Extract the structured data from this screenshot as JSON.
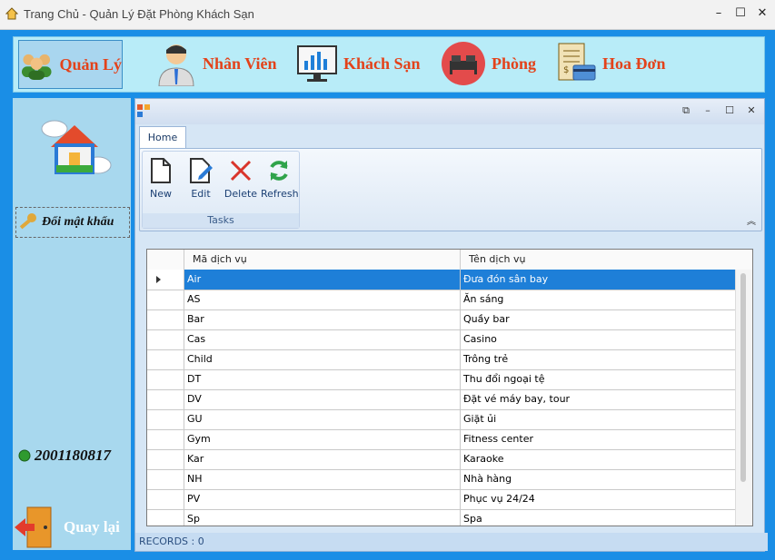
{
  "window": {
    "title": "Trang Chủ - Quản Lý Đặt Phòng Khách Sạn",
    "controls": [
      "–",
      "☐",
      "✕"
    ]
  },
  "topnav": [
    {
      "label": "Quản Lý",
      "icon": "users-group-icon"
    },
    {
      "label": "Nhân Viên",
      "icon": "employee-icon"
    },
    {
      "label": "Khách Sạn",
      "icon": "monitor-chart-icon"
    },
    {
      "label": "Phòng",
      "icon": "bed-icon"
    },
    {
      "label": "Hoa Đơn",
      "icon": "invoice-icon"
    }
  ],
  "sidebar": {
    "change_password": "Đổi mật khẩu",
    "user_id": "2001180817",
    "back": "Quay lại"
  },
  "child": {
    "tab": "Home",
    "ribbon": {
      "group": "Tasks",
      "buttons": [
        "New",
        "Edit",
        "Delete",
        "Refresh"
      ]
    },
    "grid": {
      "headers": [
        "Mã dịch vụ",
        "Tên dịch vụ"
      ],
      "rows": [
        [
          "Air",
          "Đưa đón sân bay"
        ],
        [
          "AS",
          "Ăn sáng"
        ],
        [
          "Bar",
          "Quầy bar"
        ],
        [
          "Cas",
          "Casino"
        ],
        [
          "Child",
          "Trông trẻ"
        ],
        [
          "DT",
          "Thu đổi ngoại tệ"
        ],
        [
          "DV",
          "Đặt vé máy bay, tour"
        ],
        [
          "GU",
          "Giặt ủi"
        ],
        [
          "Gym",
          "Fitness center"
        ],
        [
          "Kar",
          "Karaoke"
        ],
        [
          "NH",
          "Nhà hàng"
        ],
        [
          "PV",
          "Phục vụ 24/24"
        ],
        [
          "Sp",
          "Spa"
        ]
      ],
      "selected_row": 0
    },
    "status": "RECORDS : 0"
  },
  "colors": {
    "accent": "#1e7fd8",
    "nav_text": "#e3421a",
    "nav_bg": "#b8ecf8"
  }
}
